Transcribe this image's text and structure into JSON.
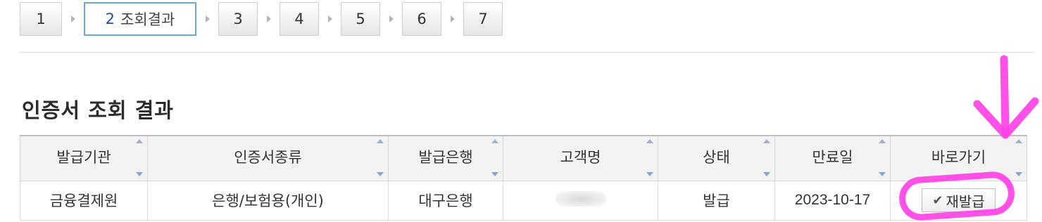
{
  "steps": [
    {
      "num": "1"
    },
    {
      "num": "2",
      "suffix": "조회결과"
    },
    {
      "num": "3"
    },
    {
      "num": "4"
    },
    {
      "num": "5"
    },
    {
      "num": "6"
    },
    {
      "num": "7"
    }
  ],
  "page_title": "인증서 조회 결과",
  "table": {
    "headers": [
      "발급기관",
      "인증서종류",
      "발급은행",
      "고객명",
      "상태",
      "만료일",
      "바로가기"
    ],
    "rows": [
      {
        "issuer": "금융결제원",
        "cert_type": "은행/보험용(개인)",
        "bank": "대구은행",
        "customer": "",
        "status": "발급",
        "expiry": "2023-10-17",
        "action": "재발급"
      }
    ]
  },
  "colors": {
    "active_step_border": "#6aa6e6",
    "annotation": "#ff3ee4"
  }
}
